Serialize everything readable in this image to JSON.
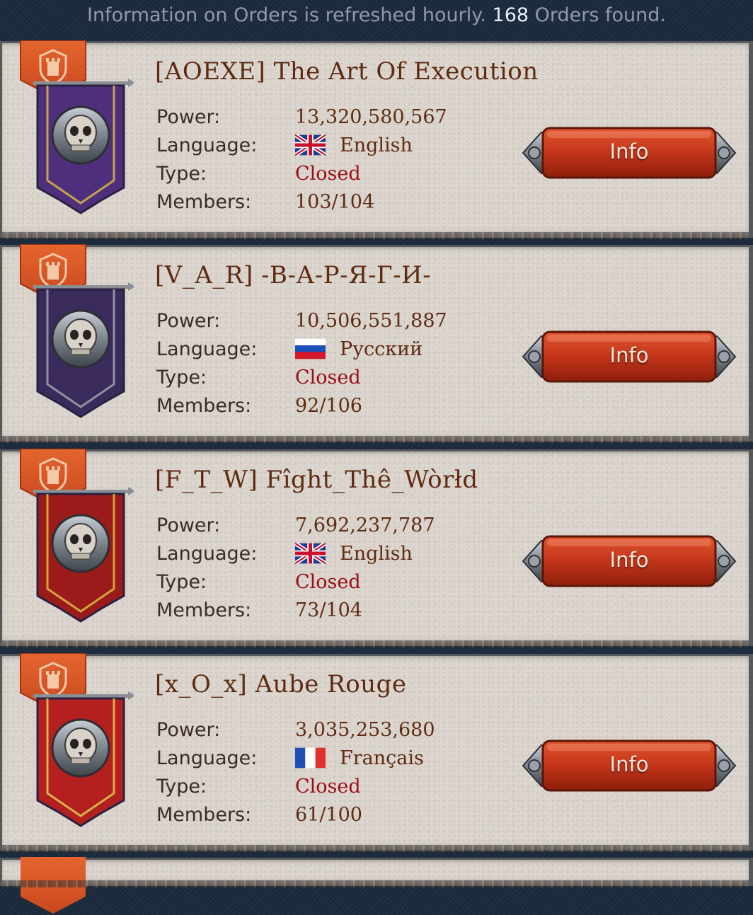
{
  "header": {
    "info_text": "Information on Orders is refreshed hourly.",
    "count": "168",
    "suffix": "Orders found."
  },
  "labels": {
    "power": "Power:",
    "language": "Language:",
    "type": "Type:",
    "members": "Members:"
  },
  "info_button_label": "Info",
  "colors": {
    "banner_tab": "#d9582a",
    "button": "#c33519",
    "closed": "#9b0c12",
    "name": "#5e2a10"
  },
  "orders": [
    {
      "name": "[AOEXE] The Art Of Execution",
      "power": "13,320,580,567",
      "language": "English",
      "flag": "uk-flag-icon",
      "type": "Closed",
      "members": "103/104",
      "crest": "skull-crest-icon"
    },
    {
      "name": "[V_A_R] -В-А-Р-Я-Г-И-",
      "power": "10,506,551,887",
      "language": "Русский",
      "flag": "russia-flag-icon",
      "type": "Closed",
      "members": "92/106",
      "crest": "wolf-crest-icon"
    },
    {
      "name": "[F_T_W] Fîght_Thê_Wòrłd",
      "power": "7,692,237,787",
      "language": "English",
      "flag": "uk-flag-icon",
      "type": "Closed",
      "members": "73/104",
      "crest": "horned-skull-crest-icon"
    },
    {
      "name": "[x_O_x] Aube Rouge",
      "power": "3,035,253,680",
      "language": "Français",
      "flag": "france-flag-icon",
      "type": "Closed",
      "members": "61/100",
      "crest": "helmet-crest-icon"
    }
  ]
}
